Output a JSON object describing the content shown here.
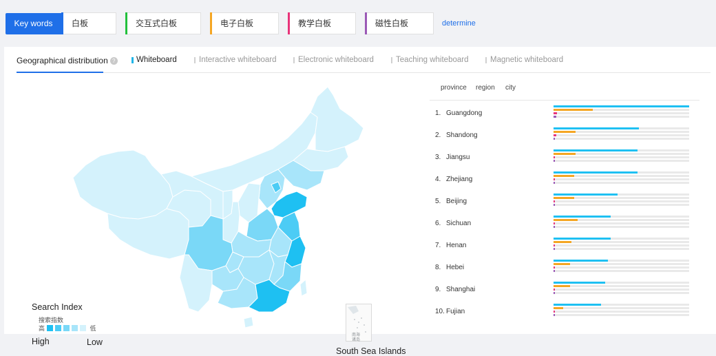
{
  "keywords": {
    "label": "Key words",
    "items": [
      {
        "text": "白板",
        "color": "#1f6fe8"
      },
      {
        "text": "交互式白板",
        "color": "#22c03c"
      },
      {
        "text": "电子白板",
        "color": "#f5a623"
      },
      {
        "text": "教学白板",
        "color": "#e8347a"
      },
      {
        "text": "磁性白板",
        "color": "#9b59b6"
      }
    ],
    "determine": "determine"
  },
  "tabs": {
    "main": "Geographical distribution",
    "help": "?",
    "series": [
      "Whiteboard",
      "Interactive whiteboard",
      "Electronic whiteboard",
      "Teaching whiteboard",
      "Magnetic whiteboard"
    ]
  },
  "map": {
    "legend_title": "Search Index",
    "legend_sub": "搜索指数",
    "legend_high_cn": "高",
    "legend_low_cn": "低",
    "legend_high": "High",
    "legend_low": "Low",
    "legend_colors": [
      "#1ec0f2",
      "#4cccf5",
      "#7ad8f7",
      "#a8e5fa",
      "#d4f2fc"
    ],
    "south_sea": "South Sea Islands",
    "south_sea_cn": [
      "南海",
      "诸岛"
    ]
  },
  "ranking": {
    "headers": [
      "province",
      "region",
      "city"
    ],
    "colors": {
      "whiteboard": "#1ec0f2",
      "electronic": "#f5a623",
      "teaching": "#e8347a",
      "magnetic": "#9b59b6"
    },
    "rows": [
      {
        "rank": "1.",
        "name": "Guangdong",
        "values": [
          1.0,
          0.29,
          0.025,
          0.02
        ]
      },
      {
        "rank": "2.",
        "name": "Shandong",
        "values": [
          0.63,
          0.16,
          0.02,
          0.0
        ]
      },
      {
        "rank": "3.",
        "name": "Jiangsu",
        "values": [
          0.62,
          0.16,
          0.01,
          0.0
        ]
      },
      {
        "rank": "4.",
        "name": "Zhejiang",
        "values": [
          0.62,
          0.15,
          0.01,
          0.0
        ]
      },
      {
        "rank": "5.",
        "name": "Beijing",
        "values": [
          0.47,
          0.15,
          0.01,
          0.0
        ]
      },
      {
        "rank": "6.",
        "name": "Sichuan",
        "values": [
          0.42,
          0.18,
          0.01,
          0.0
        ]
      },
      {
        "rank": "7.",
        "name": "Henan",
        "values": [
          0.42,
          0.13,
          0.01,
          0.0
        ]
      },
      {
        "rank": "8.",
        "name": "Hebei",
        "values": [
          0.4,
          0.12,
          0.01,
          0.0
        ]
      },
      {
        "rank": "9.",
        "name": "Shanghai",
        "values": [
          0.38,
          0.12,
          0.01,
          0.0
        ]
      },
      {
        "rank": "10.",
        "name": "Fujian",
        "values": [
          0.35,
          0.07,
          0.01,
          0.0
        ]
      }
    ]
  }
}
